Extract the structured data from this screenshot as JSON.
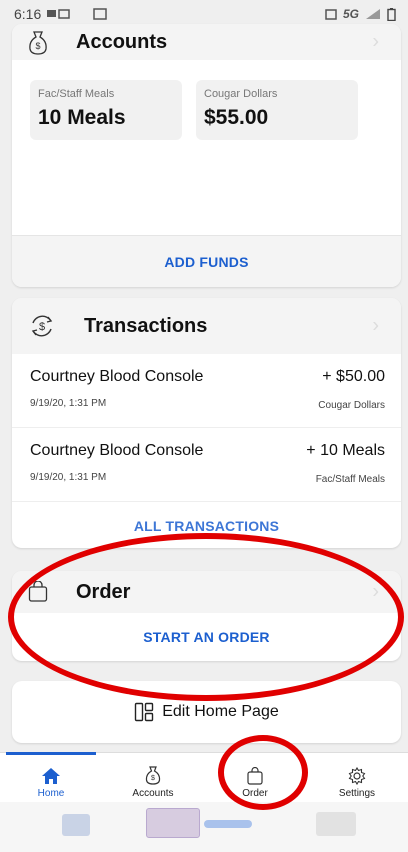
{
  "status_bar": {
    "time": "6:16",
    "network": "5G"
  },
  "accounts": {
    "title": "Accounts",
    "icon": "money-bag-icon",
    "balances": [
      {
        "label": "Fac/Staff Meals",
        "value": "10 Meals"
      },
      {
        "label": "Cougar Dollars",
        "value": "$55.00"
      }
    ],
    "add_funds": "ADD FUNDS"
  },
  "transactions": {
    "title": "Transactions",
    "icon": "refresh-dollar-icon",
    "items": [
      {
        "name": "Courtney Blood Console",
        "amount": "+ $50.00",
        "date": "9/19/20, 1:31 PM",
        "account": "Cougar Dollars"
      },
      {
        "name": "Courtney Blood Console",
        "amount": "+ 10 Meals",
        "date": "9/19/20, 1:31 PM",
        "account": "Fac/Staff Meals"
      }
    ],
    "all_link": "ALL TRANSACTIONS"
  },
  "order": {
    "title": "Order",
    "icon": "shopping-bag-icon",
    "start": "START AN ORDER"
  },
  "edit_home": {
    "label": "Edit Home Page",
    "icon": "layout-icon"
  },
  "tabs": [
    {
      "label": "Home",
      "icon": "home-icon",
      "active": true
    },
    {
      "label": "Accounts",
      "icon": "money-bag-icon",
      "active": false
    },
    {
      "label": "Order",
      "icon": "shopping-bag-icon",
      "active": false
    },
    {
      "label": "Settings",
      "icon": "gear-icon",
      "active": false
    }
  ],
  "colors": {
    "accent": "#1c5fcf",
    "annotation": "#e00000",
    "card_header": "#f4f4f4",
    "background": "#efefef"
  }
}
